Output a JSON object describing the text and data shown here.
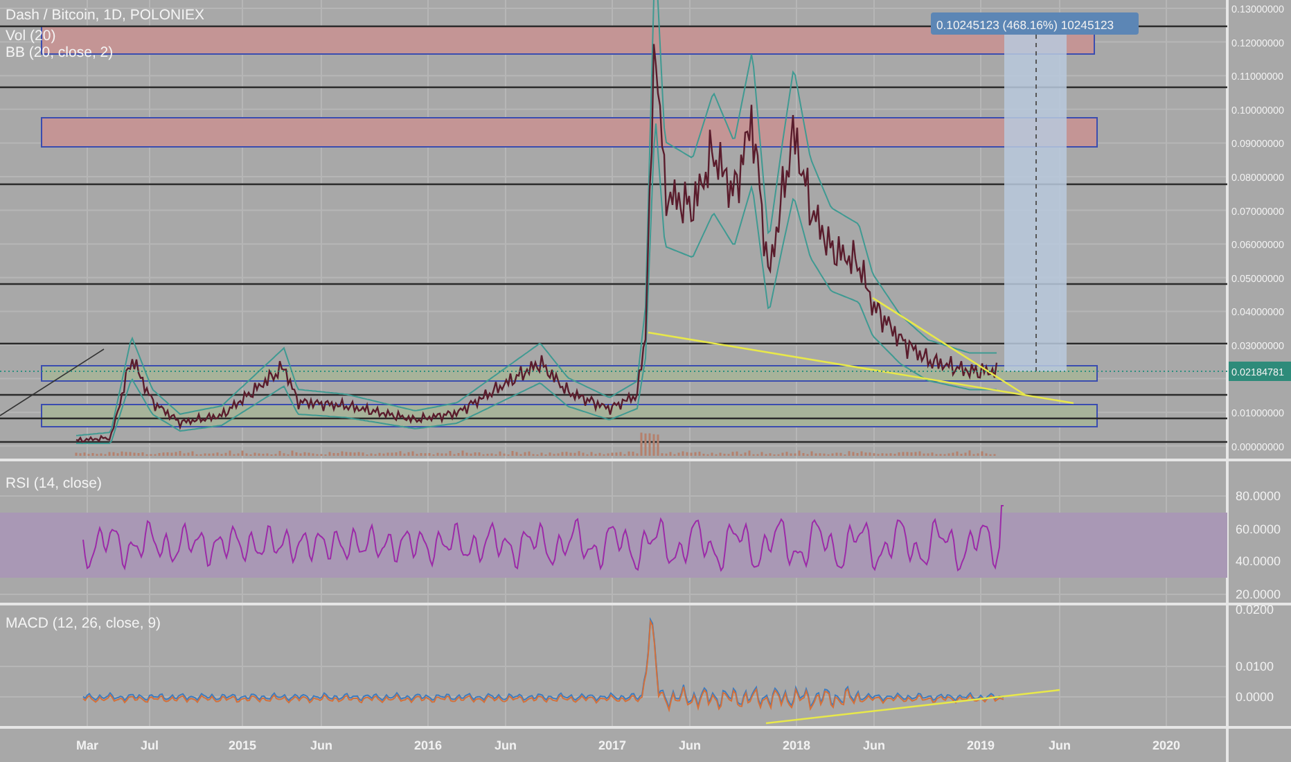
{
  "chart": {
    "title": "Dash / Bitcoin, 1D, POLONIEX",
    "indicators": [
      "Vol (20)",
      "BB (20, close, 2)"
    ],
    "measure_label": "0.10245123 (468.16%) 10245123",
    "price_label": "0.02184781",
    "price_axis": [
      "0.13000000",
      "0.12000000",
      "0.11000000",
      "0.10000000",
      "0.09000000",
      "0.08000000",
      "0.07000000",
      "0.06000000",
      "0.05000000",
      "0.04000000",
      "0.03000000",
      "0.01000000",
      "0.00000000"
    ]
  },
  "rsi": {
    "title": "RSI (14, close)",
    "axis": [
      "80.0000",
      "60.0000",
      "40.0000",
      "20.0000"
    ]
  },
  "macd": {
    "title": "MACD (12, 26, close, 9)",
    "axis": [
      "0.0200",
      "0.0100",
      "0.0000"
    ]
  },
  "time_axis": [
    "Mar",
    "Jul",
    "2015",
    "Jun",
    "2016",
    "Jun",
    "2017",
    "Jun",
    "2018",
    "Jun",
    "2019",
    "Jun",
    "2020"
  ]
}
